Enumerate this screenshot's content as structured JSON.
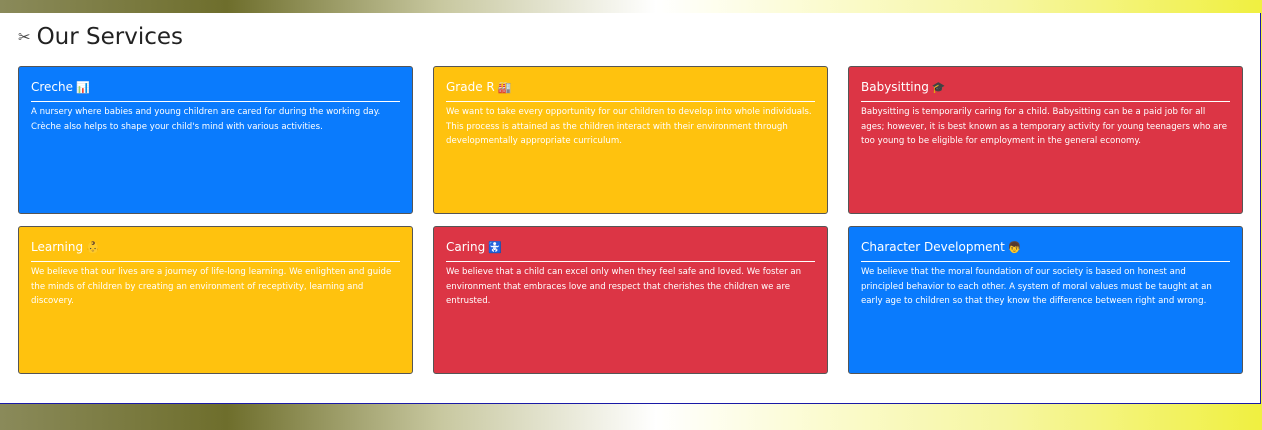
{
  "header": {
    "title": "Our Services",
    "icon": "tools-icon",
    "icon_glyph": "✂"
  },
  "colors": {
    "blue": "#0a7bfd",
    "yellow": "#ffc20e",
    "red": "#dc3545"
  },
  "services": [
    {
      "title": "Creche",
      "emoji": "📊",
      "icon": "chart-icon",
      "color": "blue",
      "description": "A nursery where babies and young children are cared for during the working day. Crèche also helps to shape your child's mind with various activities."
    },
    {
      "title": "Grade R",
      "emoji": "🏭",
      "icon": "building-icon",
      "color": "yellow",
      "description": "We want to take every opportunity for our children to develop into whole individuals. This process is attained as the children interact with their environment through developmentally appropriate curriculum."
    },
    {
      "title": "Babysitting",
      "emoji": "🎓",
      "icon": "graduation-cap-icon",
      "color": "red",
      "description": "Babysitting is temporarily caring for a child. Babysitting can be a paid job for all ages; however, it is best known as a temporary activity for young teenagers who are too young to be eligible for employment in the general economy."
    },
    {
      "title": "Learning",
      "emoji": "👶",
      "icon": "baby-icon",
      "color": "yellow",
      "description": "We believe that our lives are a journey of life-long learning. We enlighten and guide the minds of children by creating an environment of receptivity, learning and discovery."
    },
    {
      "title": "Caring",
      "emoji": "🚼",
      "icon": "baby-symbol-icon",
      "color": "red",
      "description": "We believe that a child can excel only when they feel safe and loved. We foster an environment that embraces love and respect that cherishes the children we are entrusted."
    },
    {
      "title": "Character Development",
      "emoji": "👦",
      "icon": "child-icon",
      "color": "blue",
      "description": "We believe that the moral foundation of our society is based on honest and principled behavior to each other. A system of moral values must be taught at an early age to children so that they know the difference between right and wrong."
    }
  ]
}
